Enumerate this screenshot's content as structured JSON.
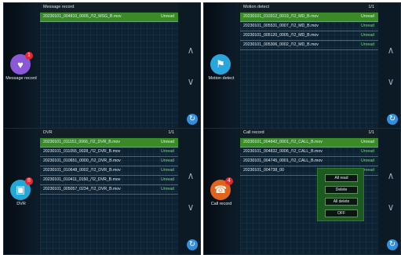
{
  "colors": {
    "selected_row": "#3a8a2a",
    "status_text": "#6ee06a",
    "badge": "#e2282f",
    "back_button": "#2f8fe0",
    "menu_bg": "#1d5a20"
  },
  "panels": [
    {
      "title": "Message record",
      "page": "",
      "side_label": "Message record",
      "icon": "heart-message-icon",
      "icon_color": "#8a58d8",
      "badge": "1",
      "rows": [
        {
          "file": "20230101_004810_0005_/'I2_MSG_B.mov",
          "status": "Unread"
        }
      ]
    },
    {
      "title": "Motion detect",
      "page": "1/1",
      "side_label": "Motion detect",
      "icon": "person-motion-icon",
      "icon_color": "#2aa6df",
      "badge": "",
      "rows": [
        {
          "file": "20230101_010312_0019_/'I2_MD_B.mov",
          "status": "Unread"
        },
        {
          "file": "20230101_005531_0007_/'I2_MD_B.mov",
          "status": "Unread"
        },
        {
          "file": "20230101_005120_0005_/'I2_MD_B.mov",
          "status": "Unread"
        },
        {
          "file": "20230101_005306_0002_/'I2_MD_B.mov",
          "status": "Unread"
        }
      ]
    },
    {
      "title": "DVR",
      "page": "1/1",
      "side_label": "DVR",
      "icon": "dvr-icon",
      "icon_color": "#22a7d6",
      "badge": "8",
      "rows": [
        {
          "file": "20230101_011151_0066_/'I2_DVR_B.mov",
          "status": "Unread"
        },
        {
          "file": "20230101_011055_0028_/'I2_DVR_B.mov",
          "status": "Unread"
        },
        {
          "file": "20230101_010651_0000_/'I2_DVR_B.mov",
          "status": "Unread"
        },
        {
          "file": "20230101_010648_0002_/'I2_DVR_B.mov",
          "status": "Unread"
        },
        {
          "file": "20230101_010411_0150_/'I2_DVR_B.mov",
          "status": "Unread"
        },
        {
          "file": "20230101_005057_0234_/'I2_DVR_B.mov",
          "status": "Unread"
        }
      ]
    },
    {
      "title": "Call record",
      "page": "1/1",
      "side_label": "Call record",
      "icon": "phone-call-icon",
      "icon_color": "#e0641e",
      "badge": "4",
      "rows": [
        {
          "file": "20230101_004842_0001_/'I2_CALL_B.mov",
          "status": "Unread"
        },
        {
          "file": "20230101_004832_0006_/'I2_CALL_B.mov",
          "status": "Unread"
        },
        {
          "file": "20230101_004745_0001_/'I2_CALL_B.mov",
          "status": "Unread"
        },
        {
          "file": "20230101_004738_00",
          "status": "Unread"
        }
      ],
      "menu": [
        "All read",
        "Delete",
        "All delete",
        "OFF"
      ]
    }
  ]
}
